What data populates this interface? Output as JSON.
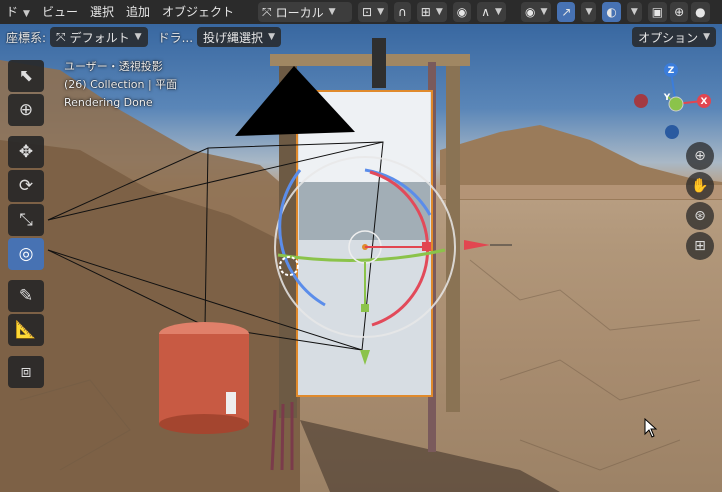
{
  "header": {
    "editor_type_label": "ド",
    "menus": [
      "ビュー",
      "選択",
      "追加",
      "オブジェクト"
    ],
    "orientation_label": "ローカル"
  },
  "tool_settings": {
    "orientation_label": "座標系:",
    "orientation_value": "デフォルト",
    "drag_label": "ドラ...",
    "drag_value": "投げ縄選択",
    "options_label": "オプション"
  },
  "overlay": {
    "view_label": "ユーザー・透視投影",
    "collection_label": "(26) Collection | 平面",
    "status_label": "Rendering Done"
  },
  "gizmo": {
    "z_label": "Z",
    "y_label": "Y",
    "x_label": "X"
  },
  "colors": {
    "accent": "#4772b3",
    "x_axis": "#e24650",
    "y_axis": "#8bc34a",
    "z_axis": "#3b7ddb"
  }
}
